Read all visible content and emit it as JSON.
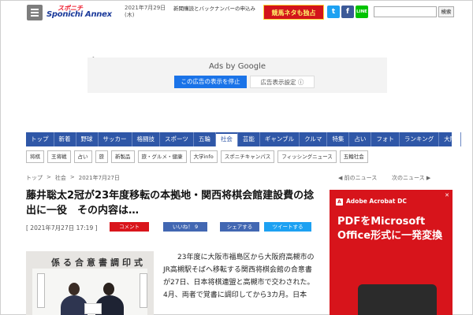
{
  "header": {
    "logo_top": "スポニチ",
    "logo_main": "Sponichi Annex",
    "date": "2021年7月29日(木)",
    "ticker": "新聞購読とバックナンバーの申込み",
    "banner": "競馬ネタも独占",
    "sns": {
      "twitter": "t",
      "facebook": "f",
      "line": "LINE"
    },
    "search_placeholder": "",
    "search_button": "検索"
  },
  "ad": {
    "ads_by": "Ads by Google",
    "stop_label": "この広告の表示を停止",
    "settings_label": "広告表示設定 ⓘ"
  },
  "nav": {
    "items": [
      "トップ",
      "新着",
      "野球",
      "サッカー",
      "格闘技",
      "スポーツ",
      "五輪",
      "社会",
      "芸能",
      "ギャンブル",
      "クルマ",
      "特集",
      "占い",
      "フォト",
      "ランキング",
      "大阪"
    ],
    "active_index": 7,
    "sub_items": [
      "将棋",
      "王将戦",
      "占い",
      "旅",
      "新製品",
      "旅・グルメ・健康",
      "大学info",
      "スポニチキャンパス",
      "フィッシングニュース",
      "五輪社会"
    ]
  },
  "breadcrumb": {
    "items": [
      "トップ",
      ">",
      "社会",
      ">",
      "2021年7月27日"
    ],
    "prev": "◀ 前のニュース",
    "next": "次のニュース ▶"
  },
  "article": {
    "title": "藤井聡太2冠が23年度移転の本拠地・関西将棋会館建設費の捻出に一役　その内容は…",
    "date": "[ 2021年7月27日 17:19 ]",
    "comment": "コメント",
    "like": "いいね！ 9",
    "share": "シェアする",
    "tweet": "ツイートする",
    "photo_banner": "係る合意書調印式",
    "body": "23年度に大阪市福島区から大阪府高槻市のJR高槻駅そばへ移転する関西将棋会館の合意書が27日、日本将棋連盟と高槻市で交わされた。4月、両者で覚書に調印してから3カ月。日本"
  },
  "side_ad": {
    "brand": "Adobe Acrobat DC",
    "headline": "PDFをMicrosoft Office形式に一発変換",
    "close": "✕"
  },
  "colors": {
    "nav_blue": "#2f57a7",
    "red": "#d9151c",
    "facebook": "#4267b2",
    "twitter": "#1da1f2"
  }
}
